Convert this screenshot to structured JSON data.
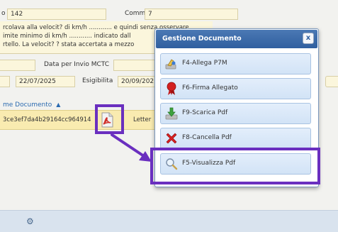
{
  "form": {
    "field_top_left_value": "142",
    "comma_label": "Comma",
    "comma_value": "7",
    "description_lines": [
      "rcolava alla velocit? di km/h ............ e quindi senza osservare",
      "imite minimo di km/h ............ indicato dall",
      "rtello. La velocit? ? stata accertata a mezzo"
    ],
    "data_invio_label": "Data per Invio MCTC",
    "date_value": "22/07/2025",
    "esigibilita_label": "Esigibilita",
    "esigibilita_value": "20/09/202"
  },
  "grid": {
    "header_label": "me Documento",
    "sort_icon": "sort-arrows-icon",
    "row": {
      "hash_value": "3ce3ef7da4b29164cc964914",
      "type_value": "Letter"
    },
    "file_icon": "pdf-file-icon"
  },
  "dialog": {
    "title": "Gestione Documento",
    "close_label": "x",
    "buttons": [
      {
        "label": "F4-Allega P7M",
        "icon": "attach-certificate-icon"
      },
      {
        "label": "F6-Firma Allegato",
        "icon": "signature-ribbon-icon"
      },
      {
        "label": "F9-Scarica Pdf",
        "icon": "download-arrow-icon"
      },
      {
        "label": "F8-Cancella Pdf",
        "icon": "delete-x-icon"
      },
      {
        "label": "F5-Visualizza Pdf",
        "icon": "magnifier-icon"
      }
    ]
  },
  "footer": {
    "gear_icon": "gear-icon",
    "gear_glyph": "⚙"
  },
  "colors": {
    "highlight": "#6a2fbf",
    "dialog_title_bg": "#2f5f9f",
    "field_bg": "#fbf6dc",
    "row_selected_bg": "#f9ebb0"
  }
}
